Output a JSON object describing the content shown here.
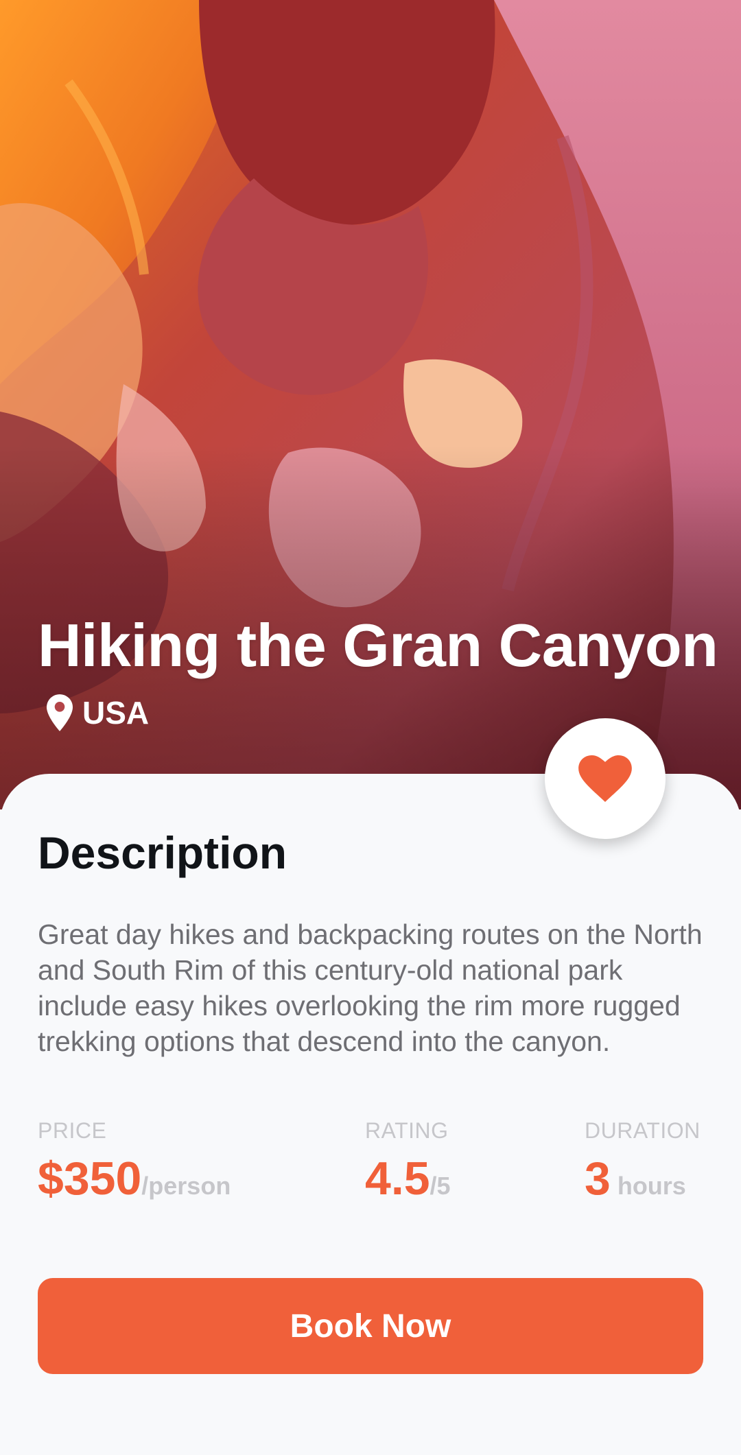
{
  "hero": {
    "title": "Hiking the Gran Canyon",
    "location": "USA",
    "image_subject": "slot canyon sandstone walls",
    "icons": {
      "location": "map-pin-icon"
    }
  },
  "favorite": {
    "icon": "heart-icon",
    "active": true
  },
  "description": {
    "heading": "Description",
    "body": "Great day hikes and backpacking routes on the North and South Rim of this century-old national park include easy hikes overlooking the rim more rugged trekking options that descend into the canyon."
  },
  "stats": {
    "price": {
      "label": "PRICE",
      "value": "$350",
      "unit": "/person"
    },
    "rating": {
      "label": "RATING",
      "value": "4.5",
      "unit": "/5"
    },
    "duration": {
      "label": "DURATION",
      "value": "3",
      "unit": " hours"
    }
  },
  "cta": {
    "label": "Book Now"
  },
  "colors": {
    "accent": "#f0603a",
    "muted": "#c6c6ca",
    "body_text": "#6e6e73",
    "heading": "#111418",
    "background": "#f8f9fb"
  }
}
